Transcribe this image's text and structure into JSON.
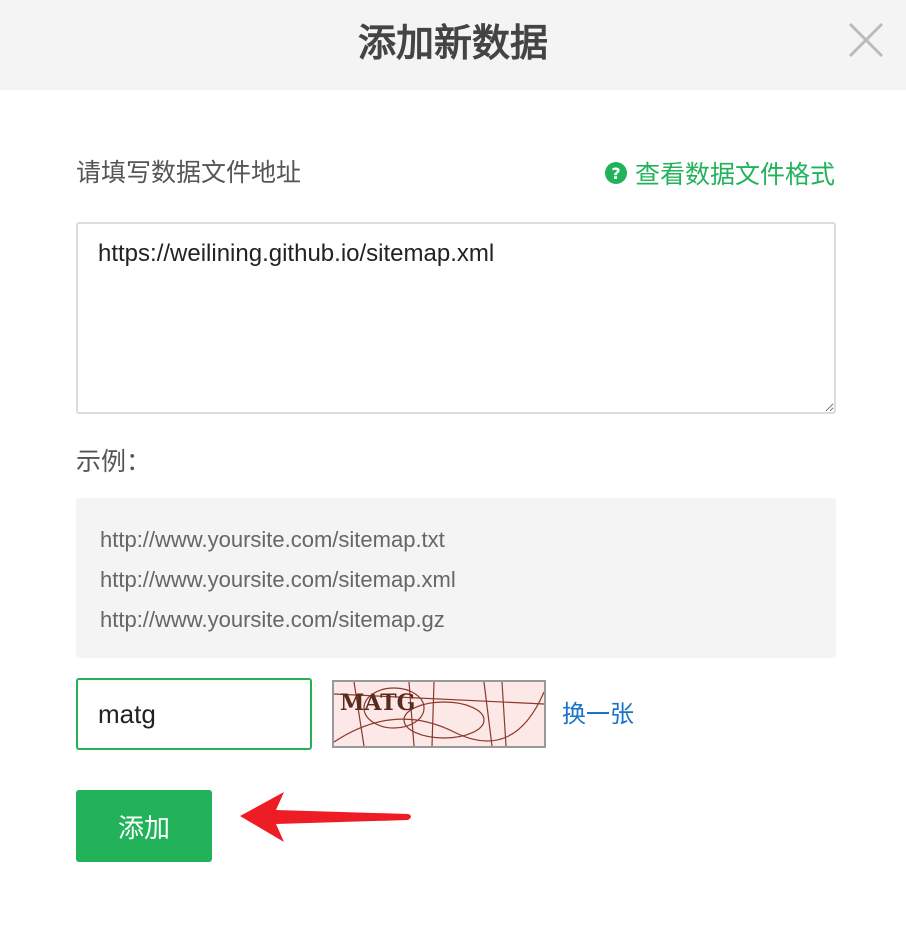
{
  "dialog": {
    "title": "添加新数据",
    "close_icon": "close-icon"
  },
  "form": {
    "url_label": "请填写数据文件地址",
    "help_link": "查看数据文件格式",
    "help_icon": "question-circle-icon",
    "url_value": "https://weilining.github.io/sitemap.xml",
    "example_label": "示例：",
    "examples": [
      "http://www.yoursite.com/sitemap.txt",
      "http://www.yoursite.com/sitemap.xml",
      "http://www.yoursite.com/sitemap.gz"
    ],
    "captcha_value": "matg",
    "captcha_text": "MATG",
    "refresh_label": "换一张",
    "submit_label": "添加"
  },
  "colors": {
    "accent": "#22b35a",
    "link": "#1a73c9",
    "annotation_arrow": "#ee1c24"
  }
}
